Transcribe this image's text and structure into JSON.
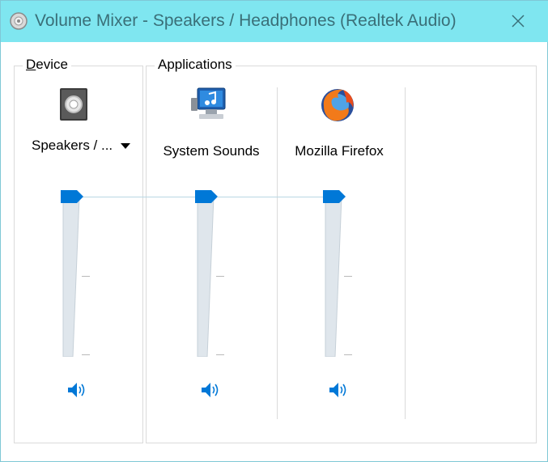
{
  "window": {
    "title": "Volume Mixer - Speakers / Headphones (Realtek Audio)",
    "titlebar_color": "#7fe6f0",
    "accent_color": "#0078d7"
  },
  "device_group": {
    "label_underlined": "D",
    "label_rest": "evice",
    "device_name": "Speakers / ...",
    "icon": "speaker-icon",
    "volume_percent": 100,
    "mute_icon": "speaker-volume-icon"
  },
  "applications_group": {
    "label": "Applications",
    "apps": [
      {
        "name": "System Sounds",
        "icon": "system-sounds-icon",
        "volume_percent": 100,
        "mute_icon": "speaker-volume-icon"
      },
      {
        "name": "Mozilla Firefox",
        "icon": "firefox-icon",
        "volume_percent": 100,
        "mute_icon": "speaker-volume-icon"
      }
    ]
  }
}
